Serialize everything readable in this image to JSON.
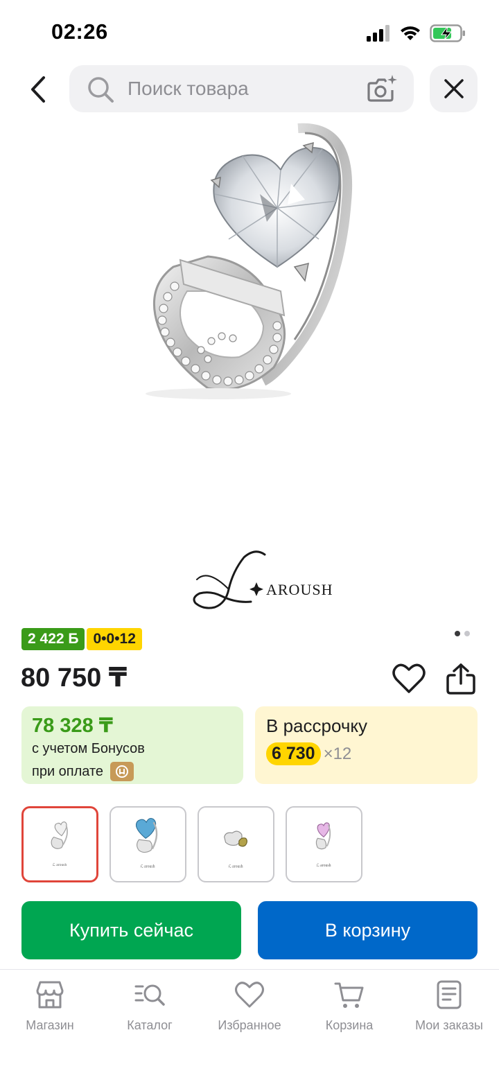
{
  "status_bar": {
    "time": "02:26"
  },
  "search": {
    "placeholder": "Поиск товара"
  },
  "product": {
    "brand": "AROUSH",
    "bonus_badge": "2 422 Б",
    "installment_badge": "0•0•12",
    "price": "80 750 ₸",
    "image_count": 2,
    "image_index": 1
  },
  "bonus_card": {
    "amount": "78 328 ₸",
    "line1": "с учетом Бонусов",
    "line2": "при оплате"
  },
  "installment_card": {
    "title": "В рассрочку",
    "monthly": "6 730",
    "term": "×12"
  },
  "variants": [
    {
      "stone": "clear",
      "selected": true
    },
    {
      "stone": "blue",
      "selected": false
    },
    {
      "stone": "olive",
      "selected": false
    },
    {
      "stone": "pink",
      "selected": false
    }
  ],
  "actions": {
    "buy_now": "Купить сейчас",
    "add_to_cart": "В корзину"
  },
  "tabbar": [
    {
      "label": "Магазин",
      "icon": "shop-icon"
    },
    {
      "label": "Каталог",
      "icon": "catalog-search-icon"
    },
    {
      "label": "Избранное",
      "icon": "heart-icon"
    },
    {
      "label": "Корзина",
      "icon": "cart-icon"
    },
    {
      "label": "Мои заказы",
      "icon": "orders-icon"
    }
  ],
  "colors": {
    "green": "#00a651",
    "blue": "#0068c9",
    "bonus_green": "#3a9b19",
    "yellow": "#ffd500",
    "selected_border": "#e0453a"
  }
}
